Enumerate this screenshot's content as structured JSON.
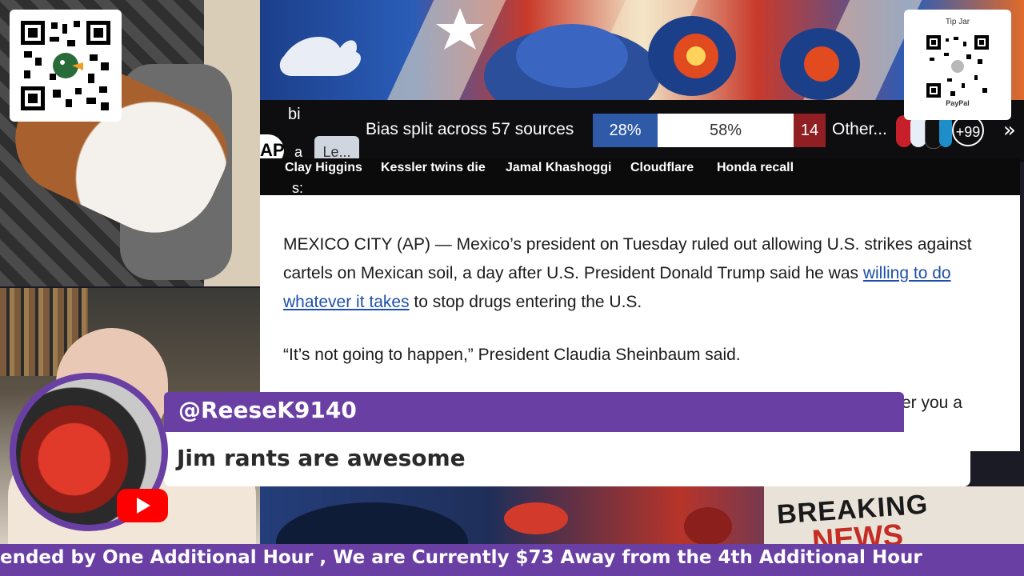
{
  "qr_left": {
    "label": "QR code with duck logo"
  },
  "tip_jar": {
    "title": "Tip Jar",
    "sub": "PayPal"
  },
  "ground": {
    "side_letters": [
      "bi",
      "a",
      "s:"
    ],
    "ap_logo": "AP",
    "learn_button": "Le...",
    "bias_text": "Bias split across 57 sources",
    "left_pct": "28%",
    "center_pct": "58%",
    "right_count": "14",
    "other_text": "Other...",
    "more_sources": "+99",
    "colors": {
      "left": "#2f5aa8",
      "center": "#ffffff",
      "right": "#8f1f22"
    }
  },
  "topics": [
    "Clay Higgins",
    "Kessler twins die",
    "Jamal Khashoggi",
    "Cloudflare",
    "Honda recall"
  ],
  "article": {
    "p1_pre": "MEXICO CITY (AP) — Mexico’s president on Tuesday ruled out allowing U.S. strikes against cartels on Mexican soil, a day after U.S. President Donald Trump said he was ",
    "p1_link": "willing to do whatever it takes",
    "p1_post": " to stop drugs entering the U.S.",
    "p2": "“It’s not going to happen,” President Claudia Sheinbaum said.",
    "p3_partial": "er you a"
  },
  "chat": {
    "username": "@ReeseK9140",
    "message": "Jim rants are awesome",
    "platform_icon": "youtube-icon"
  },
  "bottom_art": {
    "breaking": "BREAKING",
    "news": "NEWS"
  },
  "ticker": {
    "text": "ended by One Additional Hour , We are Currently $73 Away from the 4th Additional Hour"
  }
}
